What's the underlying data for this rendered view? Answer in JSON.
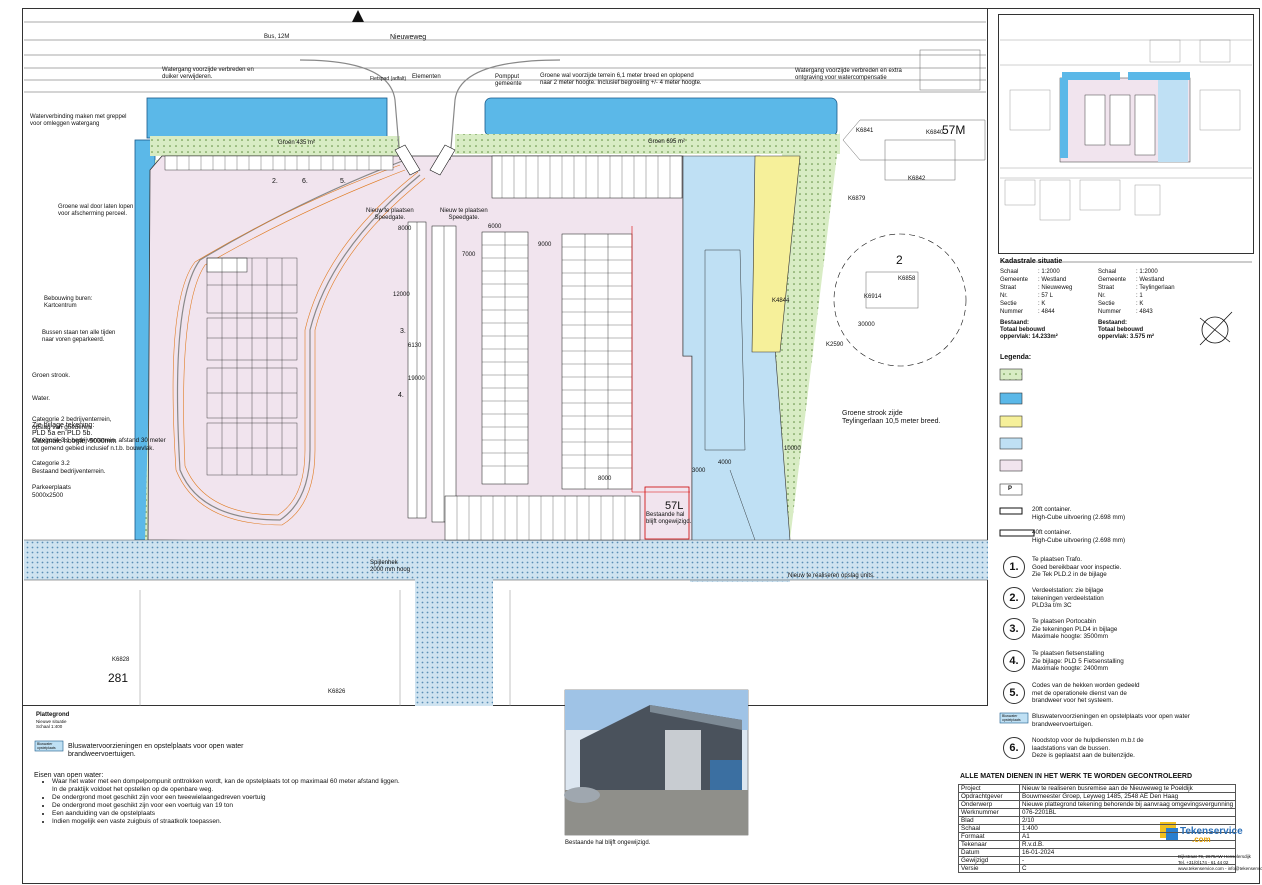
{
  "site_plan": {
    "road_top": "Nieuweweg",
    "bus_label": "Bus, 12M",
    "dim_vertical_road": [
      "7000",
      "4000",
      "2000"
    ],
    "elements": [
      "Fietspad (adfalt)",
      "Elementen"
    ],
    "pump_label": "Pompput\ngemeente",
    "green_wall_top": "Groene wal voorzijde terrein 6,1 meter breed en oplopend\nnaar 2 meter hoogte. Inclusief begroeiing +/- 4 meter hoogte.",
    "watergang_left": "Watergang voorzijde verbreden en\nduiker verwijderen.",
    "watergang_right": "Watergang voorzijde verbreden en extra\nontgraving voor watercompensatie",
    "waterverbinding": "Waterverbinding maken met greppel\nvoor omleggen watergang",
    "groene_wal_links": "Groene wal door laten lopen\nvoor afscherming perceel.",
    "bebouwing": "Bebouwing buren:\nKartcentrum",
    "bussen": "Bussen staan ten alle tijden\nnaar voren geparkeerd.",
    "bijlage": "Zie bijlage tekening:\nPLD 5a en PLD 5b.\nMaximale hoogte: 5000mm",
    "speedgate_left": "Nieuw te plaatsen\nSpeedgate.",
    "speedgate_right": "Nieuw te plaatsen\nSpeedgate.",
    "groen_left": "Groen 435 m²",
    "groen_right": "Groen 695 m²",
    "spijlenhek": "Spijlenhek\n2000 mm hoog",
    "bestaande_hal": "Bestaande hal\nblijft ongewijzigd.",
    "groene_strook": "Groene strook zijde\nTeylingerlaan 10,5 meter breed.",
    "opslag_units": "Nieuw te realiseren opslag units.",
    "plot_57": "57M",
    "plot_57l": "57L",
    "plot_281": "281",
    "plot_2": "2",
    "kadaster_refs": [
      "K6841",
      "K6840",
      "K6842",
      "K6879",
      "K6858",
      "K6914",
      "K4844",
      "K2590",
      "K6828",
      "K6826"
    ],
    "dims": [
      "7000",
      "9000",
      "6000",
      "12000",
      "19000",
      "8000",
      "30000",
      "4000",
      "10000",
      "3000",
      "6130",
      "8000"
    ],
    "circle_markers": [
      "2.",
      "6.",
      "5.",
      "3.",
      "4."
    ]
  },
  "kadaster": {
    "title": "Kadastrale situatie",
    "left": [
      [
        "Schaal",
        ": 1:2000"
      ],
      [
        "Gemeente",
        ": Westland"
      ],
      [
        "Straat",
        ": Nieuweweg"
      ],
      [
        "Nr.",
        ": 57 L"
      ],
      [
        "Sectie",
        ": K"
      ],
      [
        "Nummer",
        ": 4844"
      ]
    ],
    "right": [
      [
        "Schaal",
        ": 1:2000"
      ],
      [
        "Gemeente",
        ": Westland"
      ],
      [
        "Straat",
        ": Teylingerlaan"
      ],
      [
        "Nr.",
        ": 1"
      ],
      [
        "Sectie",
        ": K"
      ],
      [
        "Nummer",
        ": 4843"
      ]
    ],
    "bestaand_left": "Bestaand:\nTotaal bebouwd\noppervlak: 14.233m²",
    "bestaand_right": "Bestaand:\nTotaal bebouwd\noppervlak: 3.575 m²"
  },
  "legend": {
    "title": "Legenda:",
    "items": [
      {
        "text": "Groen strook.",
        "color": "#d8ecc4"
      },
      {
        "text": "Water.",
        "color": "#5bb8e8"
      },
      {
        "text": "Categorie 2 bedrijventerrein,\nopslag van goederen.",
        "color": "#f6f09a"
      },
      {
        "text": "Categorie 3.1 bedrijventerrein, afstand 30 meter\ntot gemend gebied inclusief n.t.b. bouwvlak.",
        "color": "#bfe0f4"
      },
      {
        "text": "Categorie 3.2\nBestaand bedrijventerrein.",
        "color": "#f1e4ee"
      },
      {
        "text": "Parkeerplaats\n5000x2500",
        "color": "#ffffff",
        "symbol": "P"
      },
      {
        "text": "20ft container.\nHigh-Cube uitvoering (2.698 mm)",
        "color": "#ffffff"
      },
      {
        "text": "40ft container.\nHigh-Cube uitvoering (2.698 mm)",
        "color": "#ffffff"
      }
    ],
    "numbered": [
      {
        "num": "1.",
        "text": "Te plaatsen Trafo.\nGoed bereikbaar voor inspectie.\nZie Tek PLD.2 in de bijlage"
      },
      {
        "num": "2.",
        "text": "Verdeelstation: zie bijlage\ntekeningen verdeelstation\nPLD3a t/m 3C"
      },
      {
        "num": "3.",
        "text": "Te plaatsen Portocabin\nZie tekeningen PLD4 in bijlage\nMaximale hoogte: 3500mm"
      },
      {
        "num": "4.",
        "text": "Te plaatsen fietsenstalling\nZie bijlage: PLD 5 Fietsenstalling\nMaximale hoogte: 2400mm"
      },
      {
        "num": "5.",
        "text": "Codes van de hekken worden gedeeld\nmet de operationele dienst van de\nbrandweer voor het systeem."
      }
    ],
    "blus_icon": "Bluswater\nopstelplaats",
    "blus_text": "Bluswatervoorzieningen en opstelplaats voor open water\nbrandweervoertuigen.",
    "item6_num": "6.",
    "item6_text": "Noodstop voor de hulpdiensten m.b.t de\nlaadstations van de bussen.\nDeze is geplaatst aan de buitenzijde."
  },
  "notes": {
    "plattegrond_title": "Plattegrond",
    "plattegrond_sub": "Nieuwe situatie\nSchaal 1:400",
    "blus_icon": "Bluswater\nopstelplaats",
    "blus_text": "Bluswatervoorzieningen en opstelplaats voor open water\nbrandweervoertuigen.",
    "eisen_title": "Eisen van open water:",
    "eisen": [
      "Waar het water met een dompelpompunit onttrokken wordt, kan de opstelplaats tot op maximaal 60 meter afstand liggen.",
      "In de praktijk voldoet het opstellen op de openbare weg.",
      "De ondergrond moet geschikt zijn voor een tweewielaangedreven   voertuig",
      "De ondergrond moet geschikt zijn voor een voertuig van 19 ton",
      "Een aanduiding van de opstelplaats",
      "Indien mogelijk een vaste zuigbuis of straatkolk toepassen."
    ]
  },
  "photo": {
    "caption": "Bestaande hal blijft ongewijzigd."
  },
  "title_block": {
    "header": "ALLE MATEN DIENEN IN HET WERK TE WORDEN GECONTROLEERD",
    "rows": [
      [
        "Project",
        "Nieuw te realiseren busremise aan de Nieuweweg te Poeldijk"
      ],
      [
        "Opdrachtgever",
        "Bouwmeester Groep, Leyweg 1485, 2548 AE Den Haag"
      ],
      [
        "Onderwerp",
        "Nieuwe plattegrond tekening behorende bij aanvraag omgevingsvergunning"
      ],
      [
        "Werknummer",
        "076-2201BL"
      ],
      [
        "Blad",
        "2/10"
      ],
      [
        "Schaal",
        "1:400"
      ],
      [
        "Formaat",
        "A1"
      ],
      [
        "Tekenaar",
        "R.v.d.B."
      ],
      [
        "Datum",
        "16-01-2024"
      ],
      [
        "Gewijzigd",
        "-"
      ],
      [
        "Versie",
        "C"
      ]
    ],
    "logo_name": "Tekenservice",
    "logo_sub": ".com",
    "address": "Dijkstraat 79, 2675AW Honselersdijk\nTel. +31(0)174 - 61 44 02\nwww.tekenservice.com - info@tekenservice.com"
  },
  "colors": {
    "water": "#5bb8e8",
    "green": "#d8ecc4",
    "cat2": "#f6f09a",
    "cat31": "#bfe0f4",
    "cat32": "#f1e4ee",
    "street": "#cfe3f0"
  }
}
